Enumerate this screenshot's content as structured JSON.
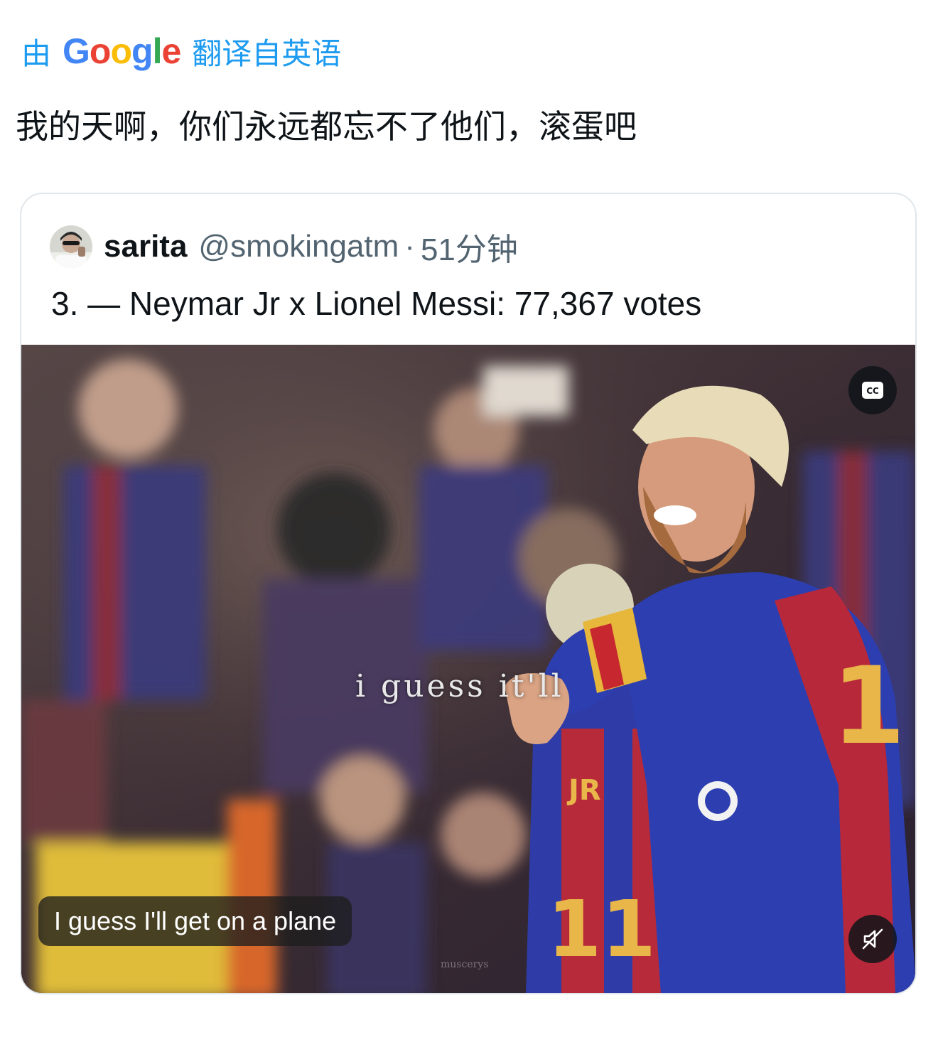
{
  "translation_bar": {
    "prefix": "由",
    "provider_letters": [
      {
        "ch": "G",
        "color": "#4285F4"
      },
      {
        "ch": "o",
        "color": "#EA4335"
      },
      {
        "ch": "o",
        "color": "#FBBC05"
      },
      {
        "ch": "g",
        "color": "#4285F4"
      },
      {
        "ch": "l",
        "color": "#34A853"
      },
      {
        "ch": "e",
        "color": "#EA4335"
      }
    ],
    "suffix": "翻译自英语"
  },
  "tweet": {
    "text": "我的天啊，你们永远都忘不了他们，滚蛋吧"
  },
  "quoted_tweet": {
    "display_name": "sarita",
    "handle": "@smokingatm",
    "separator": "·",
    "timestamp": "51分钟",
    "text": "3. — Neymar Jr x Lionel Messi: 77,367 votes",
    "video": {
      "burned_in_caption": "i guess it'll",
      "subtitle": "I guess I'll get on a plane",
      "watermark": "muscerys",
      "cc_icon": "closed-captions-icon",
      "mute_icon": "speaker-muted-icon"
    }
  },
  "colors": {
    "accent": "#1d9bf0",
    "text_primary": "#0f1419",
    "text_secondary": "#536471",
    "card_border": "#e1e6ea"
  }
}
